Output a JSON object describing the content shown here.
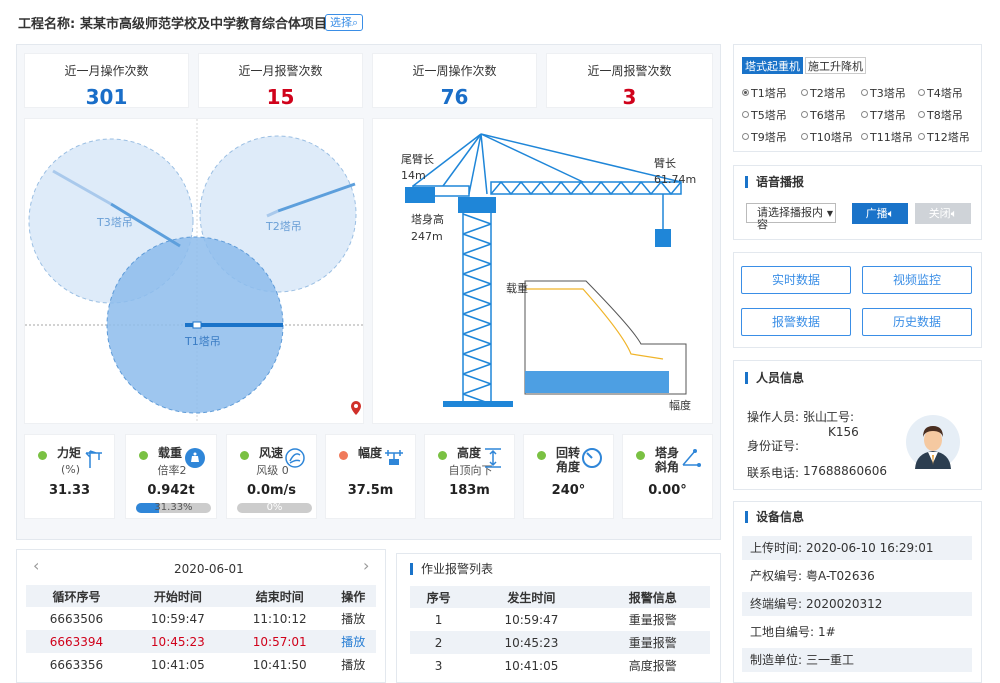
{
  "header": {
    "project_label": "工程名称:",
    "project_name": "某某市高级师范学校及中学教育综合体项目",
    "select_label": "选择"
  },
  "stats": [
    {
      "label": "近一月操作次数",
      "value": "301",
      "color": "#1a6ec8"
    },
    {
      "label": "近一月报警次数",
      "value": "15",
      "color": "#d0021b"
    },
    {
      "label": "近一周操作次数",
      "value": "76",
      "color": "#1a6ec8"
    },
    {
      "label": "近一周报警次数",
      "value": "3",
      "color": "#d0021b"
    }
  ],
  "map": {
    "cranes": [
      "T3塔吊",
      "T2塔吊",
      "T1塔吊"
    ]
  },
  "crane_diagram": {
    "tail_label": "尾臂长",
    "tail_value": "14m",
    "boom_label": "臂长",
    "boom_value": "61.74m",
    "tower_label": "塔身高",
    "tower_value": "247m",
    "load_axis": "载重",
    "range_axis": "幅度"
  },
  "sensors": [
    {
      "name": "力矩",
      "sub": "(%)",
      "value": "31.33",
      "icon": "crane-moment-icon"
    },
    {
      "name": "载重",
      "sub": "倍率2",
      "value": "0.942t",
      "bar_label": "31.33%",
      "bar_fraction": 0.3133,
      "icon": "weight-icon"
    },
    {
      "name": "风速",
      "sub": "风级 0",
      "value": "0.0m/s",
      "bar_label": "0%",
      "bar_fraction": 0,
      "icon": "wind-icon"
    },
    {
      "name": "幅度",
      "sub": "",
      "value": "37.5m",
      "icon": "range-icon",
      "alert": true
    },
    {
      "name": "高度",
      "sub": "自顶向下",
      "value": "183m",
      "icon": "height-icon"
    },
    {
      "name": "回转\n角度",
      "sub": "",
      "value": "240°",
      "icon": "rotation-icon"
    },
    {
      "name": "塔身\n斜角",
      "sub": "",
      "value": "0.00°",
      "icon": "tilt-icon"
    }
  ],
  "date_nav": {
    "date": "2020-06-01",
    "prev": "‹",
    "next": "›"
  },
  "cycle_table": {
    "headers": [
      "循环序号",
      "开始时间",
      "结束时间",
      "操作"
    ],
    "rows": [
      [
        "6663506",
        "10:59:47",
        "11:10:12",
        "播放"
      ],
      [
        "6663394",
        "10:45:23",
        "10:57:01",
        "播放"
      ],
      [
        "6663356",
        "10:41:05",
        "10:41:50",
        "播放"
      ]
    ]
  },
  "alarm_list": {
    "title": "作业报警列表",
    "headers": [
      "序号",
      "发生时间",
      "报警信息"
    ],
    "rows": [
      [
        "1",
        "10:59:47",
        "重量报警"
      ],
      [
        "2",
        "10:45:23",
        "重量报警"
      ],
      [
        "3",
        "10:41:05",
        "高度报警"
      ]
    ]
  },
  "device_tabs": [
    "塔式起重机",
    "施工升降机"
  ],
  "cranes": [
    "T1塔吊",
    "T2塔吊",
    "T3塔吊",
    "T4塔吊",
    "T5塔吊",
    "T6塔吊",
    "T7塔吊",
    "T8塔吊",
    "T9塔吊",
    "T10塔吊",
    "T11塔吊",
    "T12塔吊"
  ],
  "voice": {
    "title": "语音播报",
    "placeholder": "请选择播报内容",
    "broadcast": "广播",
    "close": "关闭"
  },
  "actions": [
    "实时数据",
    "视频监控",
    "报警数据",
    "历史数据"
  ],
  "personnel": {
    "title": "人员信息",
    "operator_label": "操作人员:",
    "operator": "张山",
    "id_label": "工号:",
    "id": "K156",
    "idcard_label": "身份证号:",
    "phone_label": "联系电话:",
    "phone": "17688860606"
  },
  "device_info": {
    "title": "设备信息",
    "rows": [
      {
        "label": "上传时间:",
        "value": "2020-06-10 16:29:01"
      },
      {
        "label": "产权编号:",
        "value": "粤A-T02636"
      },
      {
        "label": "终端编号:",
        "value": "2020020312"
      },
      {
        "label": "工地自编号:",
        "value": "1#"
      },
      {
        "label": "制造单位:",
        "value": "三一重工"
      }
    ]
  },
  "colors": {
    "accent": "#1a73c9",
    "alarm": "#d0021b",
    "tower": "#1f86d8"
  }
}
